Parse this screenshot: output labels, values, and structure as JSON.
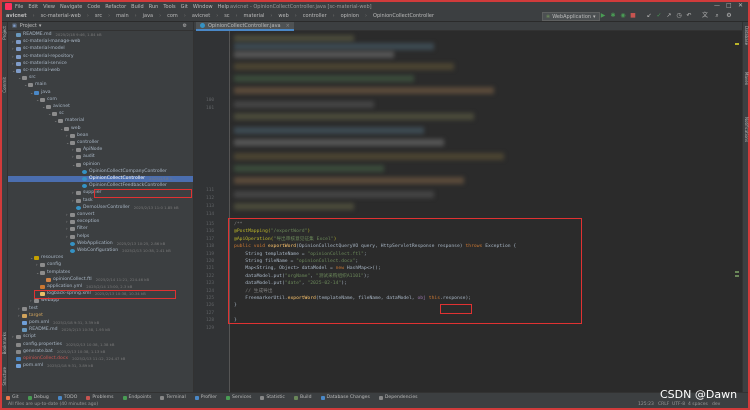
{
  "window": {
    "title": "avicnet - OpinionCollectController.java [sc-material-web]",
    "menus": [
      "File",
      "Edit",
      "View",
      "Navigate",
      "Code",
      "Refactor",
      "Build",
      "Run",
      "Tools",
      "Git",
      "Window",
      "Help"
    ],
    "controls": [
      "—",
      "□",
      "✕"
    ]
  },
  "breadcrumb": [
    "avicnet",
    "sc-material-web",
    "src",
    "main",
    "java",
    "com",
    "avicnet",
    "sc",
    "material",
    "web",
    "controller",
    "opinion",
    "OpinionCollectController"
  ],
  "toolbar": {
    "run_config": "WebApplication"
  },
  "project_panel": {
    "title": "Project",
    "tree": [
      {
        "indent": 0,
        "arrow": "",
        "label": "README.md",
        "meta": "2025/2/18 9:46, 1.84 kB",
        "color": "#a9b7c6",
        "icon": "md"
      },
      {
        "indent": 0,
        "arrow": "›",
        "label": "sc-material-manage-web",
        "meta": "",
        "color": "#a9b7c6",
        "icon": "module"
      },
      {
        "indent": 0,
        "arrow": "›",
        "label": "sc-material-model",
        "meta": "",
        "color": "#a9b7c6",
        "icon": "module"
      },
      {
        "indent": 0,
        "arrow": "›",
        "label": "sc-material-repository",
        "meta": "",
        "color": "#a9b7c6",
        "icon": "module"
      },
      {
        "indent": 0,
        "arrow": "›",
        "label": "sc-material-service",
        "meta": "",
        "color": "#a9b7c6",
        "icon": "module"
      },
      {
        "indent": 0,
        "arrow": "⌄",
        "label": "sc-material-web",
        "meta": "",
        "color": "#a9b7c6",
        "icon": "module"
      },
      {
        "indent": 1,
        "arrow": "⌄",
        "label": "src",
        "meta": "",
        "color": "#a9b7c6",
        "icon": "folder"
      },
      {
        "indent": 2,
        "arrow": "⌄",
        "label": "main",
        "meta": "",
        "color": "#a9b7c6",
        "icon": "folder"
      },
      {
        "indent": 3,
        "arrow": "⌄",
        "label": "java",
        "meta": "",
        "color": "#a9b7c6",
        "icon": "src"
      },
      {
        "indent": 4,
        "arrow": "⌄",
        "label": "com",
        "meta": "",
        "color": "#a9b7c6",
        "icon": "folder"
      },
      {
        "indent": 5,
        "arrow": "⌄",
        "label": "avicnet",
        "meta": "",
        "color": "#a9b7c6",
        "icon": "folder"
      },
      {
        "indent": 6,
        "arrow": "⌄",
        "label": "sc",
        "meta": "",
        "color": "#a9b7c6",
        "icon": "folder"
      },
      {
        "indent": 7,
        "arrow": "⌄",
        "label": "material",
        "meta": "",
        "color": "#a9b7c6",
        "icon": "folder"
      },
      {
        "indent": 8,
        "arrow": "⌄",
        "label": "web",
        "meta": "",
        "color": "#a9b7c6",
        "icon": "folder"
      },
      {
        "indent": 9,
        "arrow": "›",
        "label": "bean",
        "meta": "",
        "color": "#a9b7c6",
        "icon": "folder"
      },
      {
        "indent": 9,
        "arrow": "⌄",
        "label": "controller",
        "meta": "",
        "color": "#a9b7c6",
        "icon": "folder"
      },
      {
        "indent": 10,
        "arrow": "›",
        "label": "ApiNode",
        "meta": "",
        "color": "#a9b7c6",
        "icon": "folder"
      },
      {
        "indent": 10,
        "arrow": "›",
        "label": "audit",
        "meta": "",
        "color": "#a9b7c6",
        "icon": "folder"
      },
      {
        "indent": 10,
        "arrow": "⌄",
        "label": "opinion",
        "meta": "",
        "color": "#a9b7c6",
        "icon": "folder"
      },
      {
        "indent": 11,
        "arrow": "",
        "label": "OpinionCollectCompanyController",
        "meta": "",
        "color": "#a9b7c6",
        "icon": "class"
      },
      {
        "indent": 11,
        "arrow": "",
        "label": "OpinionCollectController",
        "meta": "2025/2/18 1...",
        "color": "#ffffff",
        "icon": "class",
        "selected": true
      },
      {
        "indent": 11,
        "arrow": "",
        "label": "OpinionCollectFeedbackController",
        "meta": "",
        "color": "#a9b7c6",
        "icon": "class"
      },
      {
        "indent": 10,
        "arrow": "›",
        "label": "supplier",
        "meta": "",
        "color": "#a9b7c6",
        "icon": "folder"
      },
      {
        "indent": 10,
        "arrow": "›",
        "label": "task",
        "meta": "",
        "color": "#a9b7c6",
        "icon": "folder"
      },
      {
        "indent": 10,
        "arrow": "",
        "label": "DemoUserController",
        "meta": "2025/2/13 11:0 1.85 kB",
        "color": "#a9b7c6",
        "icon": "class"
      },
      {
        "indent": 9,
        "arrow": "›",
        "label": "convert",
        "meta": "",
        "color": "#a9b7c6",
        "icon": "folder"
      },
      {
        "indent": 9,
        "arrow": "›",
        "label": "exception",
        "meta": "",
        "color": "#a9b7c6",
        "icon": "folder"
      },
      {
        "indent": 9,
        "arrow": "›",
        "label": "filter",
        "meta": "",
        "color": "#a9b7c6",
        "icon": "folder"
      },
      {
        "indent": 9,
        "arrow": "›",
        "label": "helps",
        "meta": "",
        "color": "#a9b7c6",
        "icon": "folder"
      },
      {
        "indent": 9,
        "arrow": "",
        "label": "WebApplication",
        "meta": "2025/2/13 10:25, 2.86 kB",
        "color": "#a9b7c6",
        "icon": "class"
      },
      {
        "indent": 9,
        "arrow": "",
        "label": "WebConfiguration",
        "meta": "2025/2/13 10:38, 2.41 kB",
        "color": "#a9b7c6",
        "icon": "class"
      },
      {
        "indent": 3,
        "arrow": "⌄",
        "label": "resources",
        "meta": "",
        "color": "#a9b7c6",
        "icon": "res"
      },
      {
        "indent": 4,
        "arrow": "›",
        "label": "config",
        "meta": "",
        "color": "#a9b7c6",
        "icon": "folder"
      },
      {
        "indent": 4,
        "arrow": "⌄",
        "label": "templates",
        "meta": "",
        "color": "#a9b7c6",
        "icon": "folder"
      },
      {
        "indent": 5,
        "arrow": "",
        "label": "opinionCollect.ftl",
        "meta": "2025/2/14 11:21, 224.46 kB",
        "color": "#a9b7c6",
        "icon": "ftl"
      },
      {
        "indent": 4,
        "arrow": "",
        "label": "application.yml",
        "meta": "2025/2/14 13:00, 2.3 kB",
        "color": "#a9b7c6",
        "icon": "yml"
      },
      {
        "indent": 4,
        "arrow": "",
        "label": "logback-spring.xml",
        "meta": "2025/2/13 10:38, 10.34 kB",
        "color": "#a9b7c6",
        "icon": "xml"
      },
      {
        "indent": 3,
        "arrow": "›",
        "label": "webapp",
        "meta": "",
        "color": "#a9b7c6",
        "icon": "folder"
      },
      {
        "indent": 1,
        "arrow": "›",
        "label": "test",
        "meta": "",
        "color": "#a9b7c6",
        "icon": "folder"
      },
      {
        "indent": 1,
        "arrow": "›",
        "label": "target",
        "meta": "",
        "color": "#d0a35c",
        "icon": "target"
      },
      {
        "indent": 1,
        "arrow": "",
        "label": "pom.xml",
        "meta": "2025/2/18 9:31, 3.39 kB",
        "color": "#a9b7c6",
        "icon": "pom"
      },
      {
        "indent": 1,
        "arrow": "",
        "label": "README.md",
        "meta": "2025/2/13 10:38, 1.95 kB",
        "color": "#a9b7c6",
        "icon": "md"
      },
      {
        "indent": 0,
        "arrow": "›",
        "label": "script",
        "meta": "",
        "color": "#a9b7c6",
        "icon": "folder"
      },
      {
        "indent": 0,
        "arrow": "",
        "label": "config.properties",
        "meta": "2025/2/13 10:38, 1.38 kB",
        "color": "#a9b7c6",
        "icon": "props"
      },
      {
        "indent": 0,
        "arrow": "",
        "label": "generate.bat",
        "meta": "2025/2/13 10:38, 1.13 kB",
        "color": "#a9b7c6",
        "icon": "bat"
      },
      {
        "indent": 0,
        "arrow": "",
        "label": "opinionCollect.docx",
        "meta": "2025/2/13 11:12, 224.47 kB",
        "color": "#c75450",
        "icon": "docx"
      },
      {
        "indent": 0,
        "arrow": "",
        "label": "pom.xml",
        "meta": "2025/2/18 9:31, 3.89 kB",
        "color": "#a9b7c6",
        "icon": "pom"
      }
    ]
  },
  "editor": {
    "tab": "OpinionCollectController.java",
    "line_numbers": [
      "115",
      "116",
      "117",
      "118",
      "119",
      "120",
      "121",
      "122",
      "123",
      "124",
      "125",
      "126",
      "127",
      "128",
      "129"
    ],
    "gutter_numbers_top": [
      "100",
      "101",
      "111",
      "112",
      "113",
      "114"
    ],
    "code_lines": [
      [
        {
          "t": "cmt",
          "v": "/**"
        }
      ],
      [
        {
          "t": "ann",
          "v": "@PostMapping("
        },
        {
          "t": "str",
          "v": "\"/exportWord\""
        },
        {
          "t": "ann",
          "v": ")"
        }
      ],
      [
        {
          "t": "ann",
          "v": "@ApiOperation("
        },
        {
          "t": "str",
          "v": "\"导出审核意见征集 Excel\""
        },
        {
          "t": "ann",
          "v": ")"
        }
      ],
      [
        {
          "t": "kw",
          "v": "public void "
        },
        {
          "t": "mth",
          "v": "exportWord"
        },
        {
          "t": "plain",
          "v": "(OpinionCollectQueryVO query, HttpServletResponse response) "
        },
        {
          "t": "kw",
          "v": "throws "
        },
        {
          "t": "plain",
          "v": "Exception {"
        }
      ],
      [
        {
          "t": "plain",
          "v": "    String templateName = "
        },
        {
          "t": "str",
          "v": "\"opinionCollect.ftl\""
        },
        {
          "t": "plain",
          "v": ";"
        }
      ],
      [
        {
          "t": "plain",
          "v": "    String fileName = "
        },
        {
          "t": "str",
          "v": "\"opinionCollect.docx\""
        },
        {
          "t": "plain",
          "v": ";"
        }
      ],
      [
        {
          "t": "plain",
          "v": "    Map<String, Object> dataModel = "
        },
        {
          "t": "kw",
          "v": "new "
        },
        {
          "t": "plain",
          "v": "HashMap<>();"
        }
      ],
      [
        {
          "t": "plain",
          "v": "    dataModel.put("
        },
        {
          "t": "str",
          "v": "\"orgName\""
        },
        {
          "t": "plain",
          "v": ", "
        },
        {
          "t": "str",
          "v": "\"测试采购组织A1101\""
        },
        {
          "t": "plain",
          "v": ");"
        }
      ],
      [
        {
          "t": "plain",
          "v": "    dataModel.put("
        },
        {
          "t": "str",
          "v": "\"date\""
        },
        {
          "t": "plain",
          "v": ", "
        },
        {
          "t": "str",
          "v": "\"2025-02-14\""
        },
        {
          "t": "plain",
          "v": ");"
        }
      ],
      [
        {
          "t": "cmt",
          "v": "    // 生成导出"
        }
      ],
      [
        {
          "t": "plain",
          "v": "    FreemarkerUtil."
        },
        {
          "t": "mth",
          "v": "exportWord"
        },
        {
          "t": "plain",
          "v": "(templateName, fileName, dataModel, "
        },
        {
          "t": "fld",
          "v": "obj "
        },
        {
          "t": "kw",
          "v": "this"
        },
        {
          "t": "plain",
          "v": ".response);"
        }
      ],
      [
        {
          "t": "plain",
          "v": "}"
        }
      ],
      [
        {
          "t": "plain",
          "v": ""
        }
      ],
      [
        {
          "t": "plain",
          "v": "}"
        }
      ],
      [
        {
          "t": "plain",
          "v": ""
        }
      ]
    ]
  },
  "bottom_tools": [
    "Git",
    "Debug",
    "TODO",
    "Problems",
    "Endpoints",
    "Terminal",
    "Profiler",
    "Services",
    "Statistic",
    "Build",
    "Database Changes",
    "Dependencies"
  ],
  "status": {
    "message": "All files are up-to-date (40 minutes ago)",
    "position": "125:23",
    "line_sep": "CRLF",
    "encoding": "UTF-8",
    "indent": "4 spaces",
    "branch": "dev"
  },
  "watermark": "CSDN @Dawn",
  "colors": {
    "accent": "#4b6eaf",
    "highlight_border": "#e03232"
  }
}
